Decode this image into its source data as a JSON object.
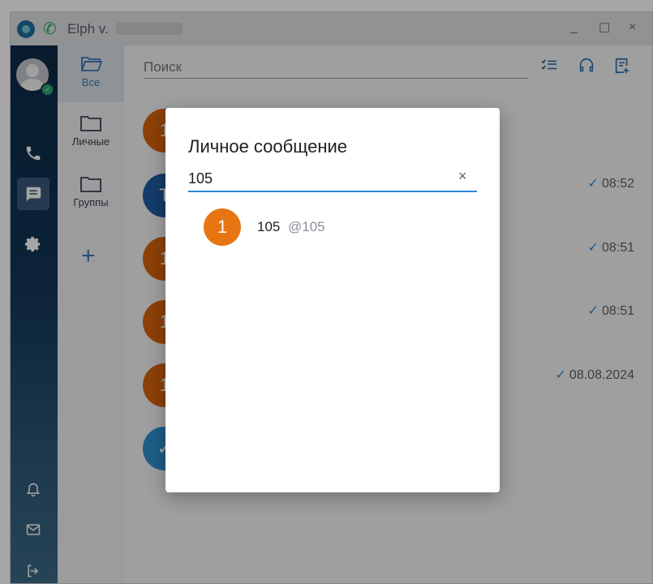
{
  "window": {
    "app_title": "Elph v."
  },
  "titlebar": {
    "minimize": "_",
    "maximize": "☐",
    "close": "×"
  },
  "rail": {
    "status": "online"
  },
  "folders": [
    {
      "label": "Все",
      "icon": "folder-open-icon",
      "active": true
    },
    {
      "label": "Личные",
      "icon": "folder-icon",
      "active": false
    },
    {
      "label": "Группы",
      "icon": "folder-icon",
      "active": false
    }
  ],
  "add_folder": "+",
  "search": {
    "placeholder": "Поиск"
  },
  "chat_list": [
    {
      "avatar_text": "1",
      "color": "#d9650d",
      "time": ""
    },
    {
      "avatar_text": "T",
      "color": "#1f5ca6",
      "time": "08:52"
    },
    {
      "avatar_text": "1",
      "color": "#d9650d",
      "time": "08:51"
    },
    {
      "avatar_text": "1",
      "color": "#d9650d",
      "time": "08:51"
    },
    {
      "avatar_text": "1",
      "color": "#d9650d",
      "time": "08.08.2024"
    },
    {
      "avatar_text": "✓",
      "color": "#2f8fd0",
      "time": ""
    }
  ],
  "dialog": {
    "title": "Личное сообщение",
    "input_value": "105",
    "clear": "×",
    "results": [
      {
        "avatar_text": "1",
        "name": "105",
        "handle": "@105"
      }
    ]
  },
  "colors": {
    "accent": "#2b86d6",
    "avatar_orange": "#e67512",
    "rail_dark": "#0d2a46"
  }
}
